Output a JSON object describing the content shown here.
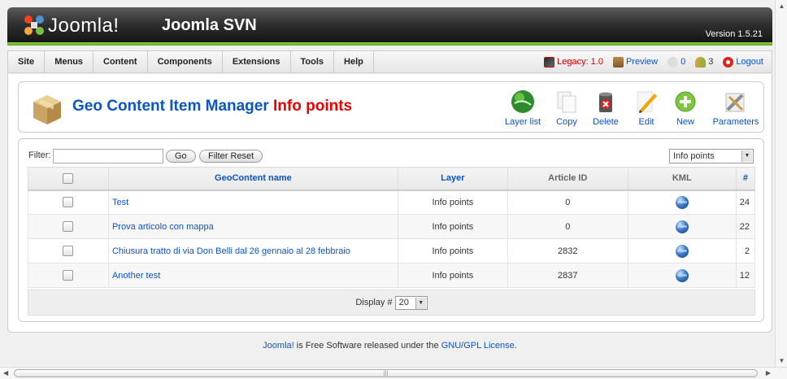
{
  "header": {
    "brand": "Joomla!",
    "site_name": "Joomla SVN",
    "version": "Version 1.5.21"
  },
  "menu": {
    "items": [
      "Site",
      "Menus",
      "Content",
      "Components",
      "Extensions",
      "Tools",
      "Help"
    ]
  },
  "status": {
    "legacy": "Legacy: 1.0",
    "preview": "Preview",
    "messages": "0",
    "users": "3",
    "logout": "Logout"
  },
  "page": {
    "title": "Geo Content Item Manager",
    "title_highlight": "Info points"
  },
  "toolbar": {
    "layer_list": "Layer list",
    "copy": "Copy",
    "delete": "Delete",
    "edit": "Edit",
    "new": "New",
    "parameters": "Parameters"
  },
  "filter": {
    "label": "Filter:",
    "value": "",
    "go": "Go",
    "reset": "Filter Reset",
    "layer_selected": "Info points"
  },
  "table": {
    "headers": {
      "name": "GeoContent name",
      "layer": "Layer",
      "article_id": "Article ID",
      "kml": "KML",
      "id": "#"
    },
    "rows": [
      {
        "name": "Test",
        "layer": "Info points",
        "article_id": "0",
        "id": "24"
      },
      {
        "name": "Prova articolo con mappa",
        "layer": "Info points",
        "article_id": "0",
        "id": "22"
      },
      {
        "name": "Chiusura tratto di via Don Belli dal 26 gennaio al 28 febbraio",
        "layer": "Info points",
        "article_id": "2832",
        "id": "2"
      },
      {
        "name": "Another test",
        "layer": "Info points",
        "article_id": "2837",
        "id": "12"
      }
    ]
  },
  "pager": {
    "label": "Display #",
    "value": "20"
  },
  "footer": {
    "joomla_link": "Joomla!",
    "text": " is Free Software released under the ",
    "license_link": "GNU/GPL License",
    "end": "."
  },
  "colors": {
    "link": "#0b55c4",
    "highlight": "#ee0000",
    "accent_green": "#6fba2c"
  }
}
